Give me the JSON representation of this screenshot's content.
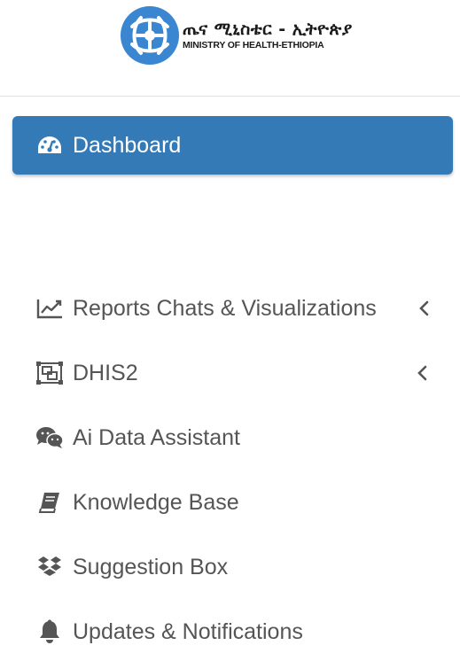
{
  "brand": {
    "name_amharic": "ጤና ሚኒስቴር - ኢትዮጵያ",
    "name_english": "MINISTRY OF HEALTH-ETHIOPIA",
    "logo_icon": "moh-emblem-icon",
    "logo_color": "#3a86d1"
  },
  "menu": {
    "items": [
      {
        "label": "Dashboard",
        "icon": "dashboard-gauge-icon",
        "active": true
      },
      {
        "label": "Reports Chats & Visualizations",
        "icon": "line-chart-icon",
        "expandable": true
      },
      {
        "label": "DHIS2",
        "icon": "object-group-icon",
        "expandable": true
      },
      {
        "label": "Ai Data Assistant",
        "icon": "chat-bubbles-icon"
      },
      {
        "label": "Knowledge Base",
        "icon": "book-icon"
      },
      {
        "label": "Suggestion Box",
        "icon": "dropbox-icon"
      },
      {
        "label": "Updates & Notifications",
        "icon": "bell-icon"
      }
    ]
  },
  "colors": {
    "active_bg": "#337ab7",
    "active_text": "#ffffff",
    "menu_text": "#555555"
  }
}
